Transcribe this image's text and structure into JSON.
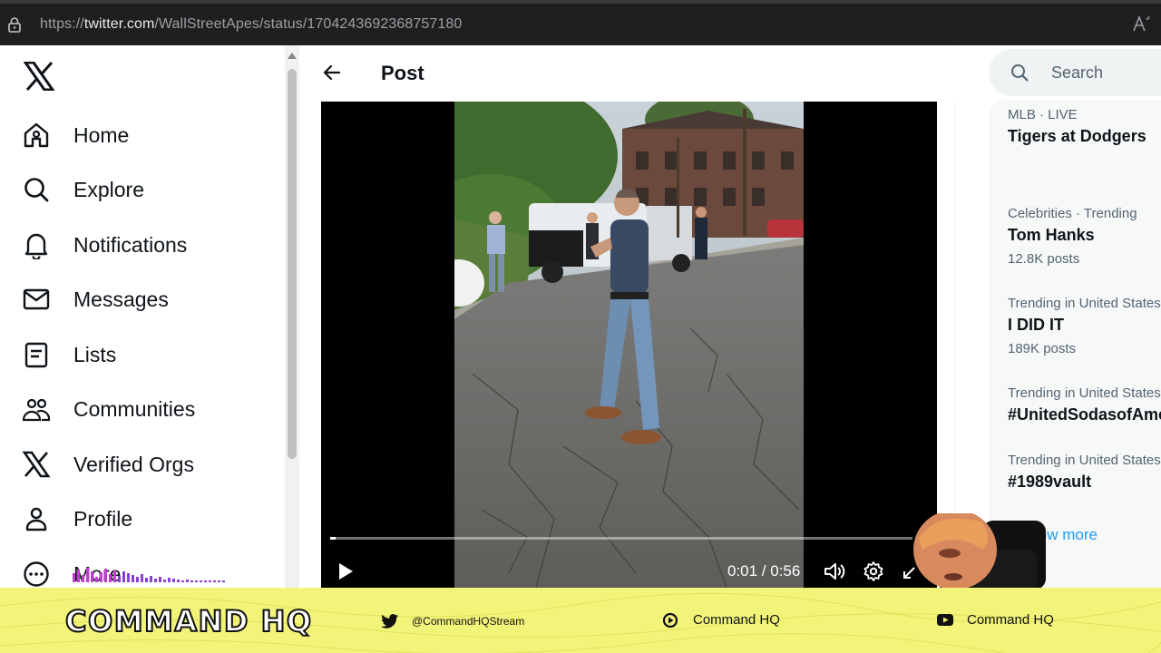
{
  "browser": {
    "url_prefix": "https://",
    "url_host": "twitter.com",
    "url_path": "/WallStreetApes/status/1704243692368757180"
  },
  "nav": {
    "items": [
      {
        "label": "Home",
        "icon": "home-icon"
      },
      {
        "label": "Explore",
        "icon": "search-icon"
      },
      {
        "label": "Notifications",
        "icon": "bell-icon"
      },
      {
        "label": "Messages",
        "icon": "envelope-icon"
      },
      {
        "label": "Lists",
        "icon": "list-icon"
      },
      {
        "label": "Communities",
        "icon": "communities-icon"
      },
      {
        "label": "Verified Orgs",
        "icon": "x-logo-icon"
      },
      {
        "label": "Profile",
        "icon": "person-icon"
      },
      {
        "label": "More",
        "icon": "more-circle-icon"
      }
    ]
  },
  "main": {
    "title": "Post",
    "video": {
      "time": "0:01 / 0:56",
      "progress": 0.01
    }
  },
  "sidebar": {
    "search_placeholder": "Search",
    "trends": [
      {
        "meta": "MLB · LIVE",
        "name": "Tigers at Dodgers",
        "count": ""
      },
      {
        "meta": "Celebrities · Trending",
        "name": "Tom Hanks",
        "count": "12.8K posts"
      },
      {
        "meta": "Trending in United States",
        "name": "I DID IT",
        "count": "189K posts"
      },
      {
        "meta": "Trending in United States",
        "name": "#UnitedSodasofAmerica",
        "count": ""
      },
      {
        "meta": "Trending in United States",
        "name": "#1989vault",
        "count": ""
      }
    ],
    "show_more": "Show more"
  },
  "banner": {
    "brand": "COMMAND HQ",
    "twitter": "@CommandHQStream",
    "kick": "Command HQ",
    "youtube": "Command HQ"
  },
  "colors": {
    "accent": "#1d9bf0",
    "banner_bg": "#f2f47a",
    "addressbar_bg": "#1f1f1f"
  }
}
